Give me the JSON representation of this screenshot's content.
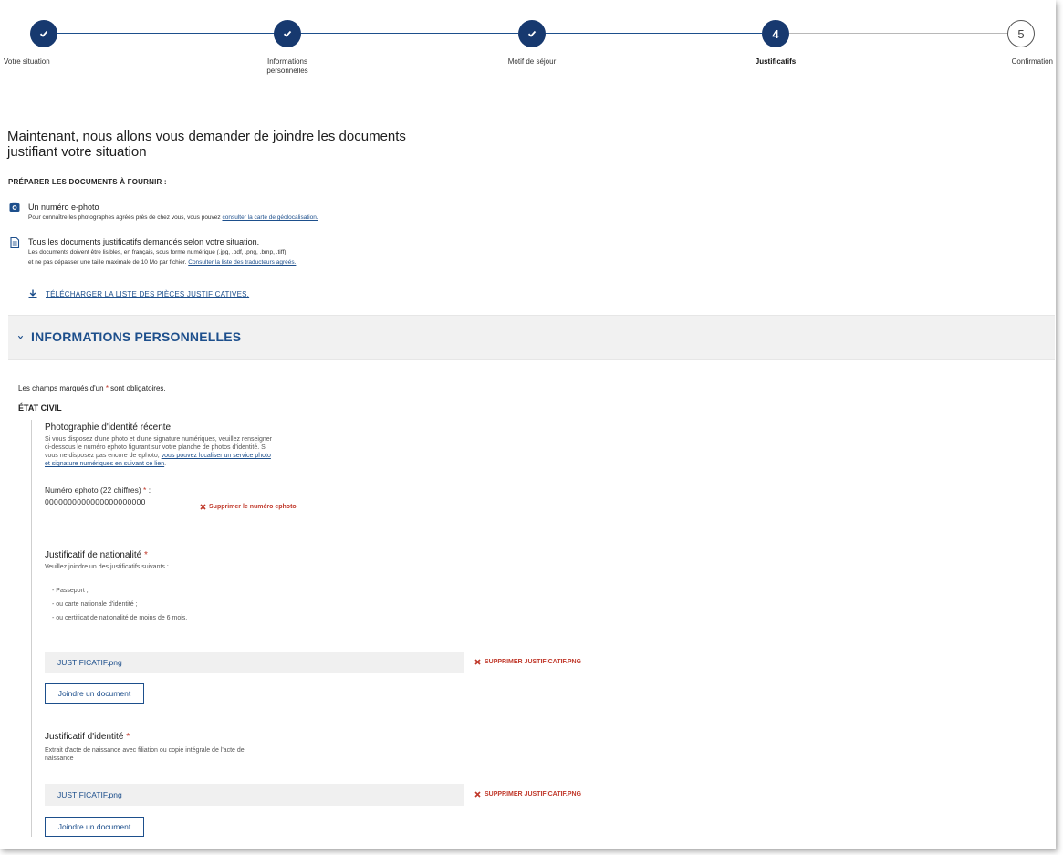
{
  "stepper": {
    "steps": [
      {
        "label": "Votre situation",
        "state": "done"
      },
      {
        "label": "Informations personnelles",
        "state": "done"
      },
      {
        "label": "Motif de séjour",
        "state": "done"
      },
      {
        "label": "Justificatifs",
        "state": "current",
        "number": "4"
      },
      {
        "label": "Confirmation",
        "state": "future",
        "number": "5"
      }
    ]
  },
  "main_title": "Maintenant, nous allons vous demander de joindre les documents justifiant votre situation",
  "prepare": {
    "heading": "PRÉPARER LES DOCUMENTS À FOURNIR :",
    "ephoto_title": "Un numéro e-photo",
    "ephoto_desc": "Pour connaître les photographes agréés près de chez vous, vous pouvez ",
    "ephoto_link": "consulter la carte de géolocalisation.",
    "docs_title": "Tous les documents justificatifs demandés selon votre situation.",
    "docs_desc_1": "Les documents doivent être lisibles, en français, sous forme numérique (.jpg, .pdf, .png, .bmp, .tiff),",
    "docs_desc_2": "et ne pas dépasser une taille maximale de 10 Mo par fichier. ",
    "docs_link": "Consulter la liste des traducteurs agréés.",
    "download_label": "TÉLÉCHARGER LA LISTE DES PIÈCES JUSTIFICATIVES."
  },
  "section": {
    "title": "INFORMATIONS PERSONNELLES"
  },
  "required_note_pre": "Les champs marqués d'un ",
  "required_note_star": "*",
  "required_note_post": " sont obligatoires.",
  "etat_civil": "ÉTAT CIVIL",
  "photo": {
    "title": "Photographie d'identité récente",
    "desc_1": "Si vous disposez d'une photo et d'une signature numériques, veuillez renseigner",
    "desc_2": "ci-dessous le numéro ephoto figurant sur votre planche de photos d'identité. Si",
    "desc_3": "vous ne disposez pas encore de ephoto, ",
    "desc_link_1": "vous pouvez localiser un service photo",
    "desc_link_2": "et signature numériques en suivant ce lien",
    "desc_end": ".",
    "ephoto_label": "Numéro ephoto (22 chiffres) ",
    "ephoto_label_star": "*",
    "ephoto_label_colon": " :",
    "ephoto_value": "0000000000000000000000",
    "delete_label": "Supprimer le numéro ephoto"
  },
  "nationality": {
    "title": "Justificatif de nationalité ",
    "star": "*",
    "desc": "Veuillez joindre un des justificatifs suivants :",
    "bullets": [
      "- Passeport ;",
      "- ou carte nationale d'identité ;",
      "- ou certificat de nationalité de moins de 6 mois."
    ],
    "file_name": "JUSTIFICATIF.png",
    "delete_label": "SUPPRIMER JUSTIFICATIF.PNG",
    "join_label": "Joindre un document"
  },
  "identity": {
    "title": "Justificatif d'identité ",
    "star": "*",
    "desc_1": "Extrait d'acte de naissance avec filiation ou copie intégrale de l'acte de",
    "desc_2": "naissance",
    "file_name": "JUSTIFICATIF.png",
    "delete_label": "SUPPRIMER JUSTIFICATIF.PNG",
    "join_label": "Joindre un document"
  },
  "colors": {
    "primary": "#17396f",
    "link": "#1d4f8c",
    "danger": "#c0392b",
    "section_bg": "#f1f1f1"
  }
}
